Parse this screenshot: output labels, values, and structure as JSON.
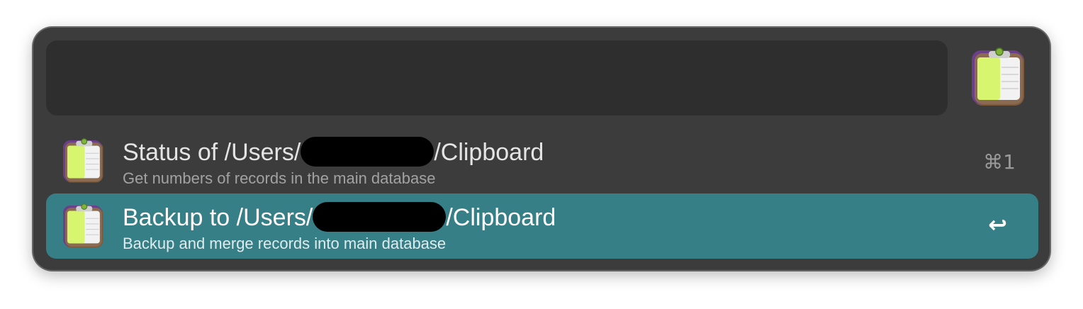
{
  "search": {
    "value": "",
    "placeholder": ""
  },
  "app_icon": "clipboard-app-icon",
  "colors": {
    "window_bg": "#3c3c3c",
    "search_bg": "#2e2e2e",
    "selected_row_bg": "#367f87",
    "title_text": "#e4e4e4",
    "subtitle_text": "#a2a2a2"
  },
  "results": [
    {
      "title_prefix": "Status of /Users/",
      "title_suffix": "/Clipboard",
      "subtitle": "Get numbers of records in the main database",
      "shortcut": "⌘1",
      "selected": false,
      "icon": "clipboard-app-icon"
    },
    {
      "title_prefix": "Backup to /Users/",
      "title_suffix": "/Clipboard",
      "subtitle": "Backup and merge records into main database",
      "shortcut": "↩",
      "selected": true,
      "icon": "clipboard-app-icon"
    }
  ]
}
